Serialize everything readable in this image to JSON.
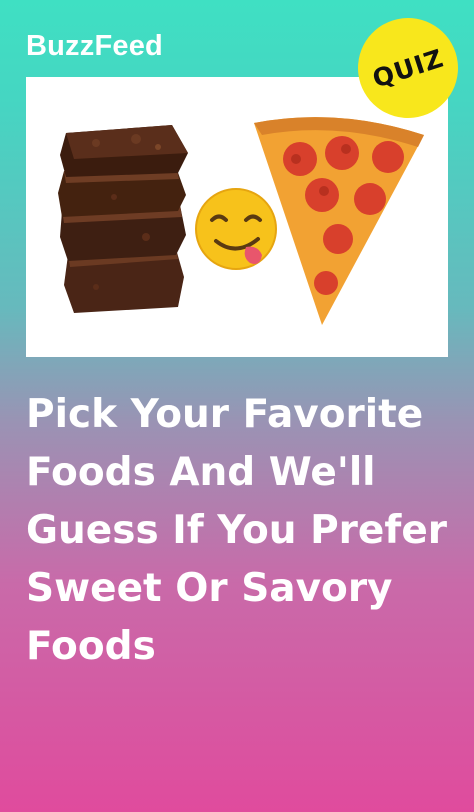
{
  "brand": {
    "name": "BuzzFeed"
  },
  "badge": {
    "label": "QUIZ"
  },
  "hero": {
    "left_food": "brownie-stack",
    "center_icon": "yum-emoji-icon",
    "right_food": "pepperoni-pizza-slice"
  },
  "headline": "Pick Your Favorite Foods And We'll Guess If You Prefer Sweet Or Savory Foods",
  "colors": {
    "gradient_top": "#3fe0c3",
    "gradient_bottom": "#e04b9d",
    "badge": "#f8e71c",
    "text": "#ffffff"
  }
}
